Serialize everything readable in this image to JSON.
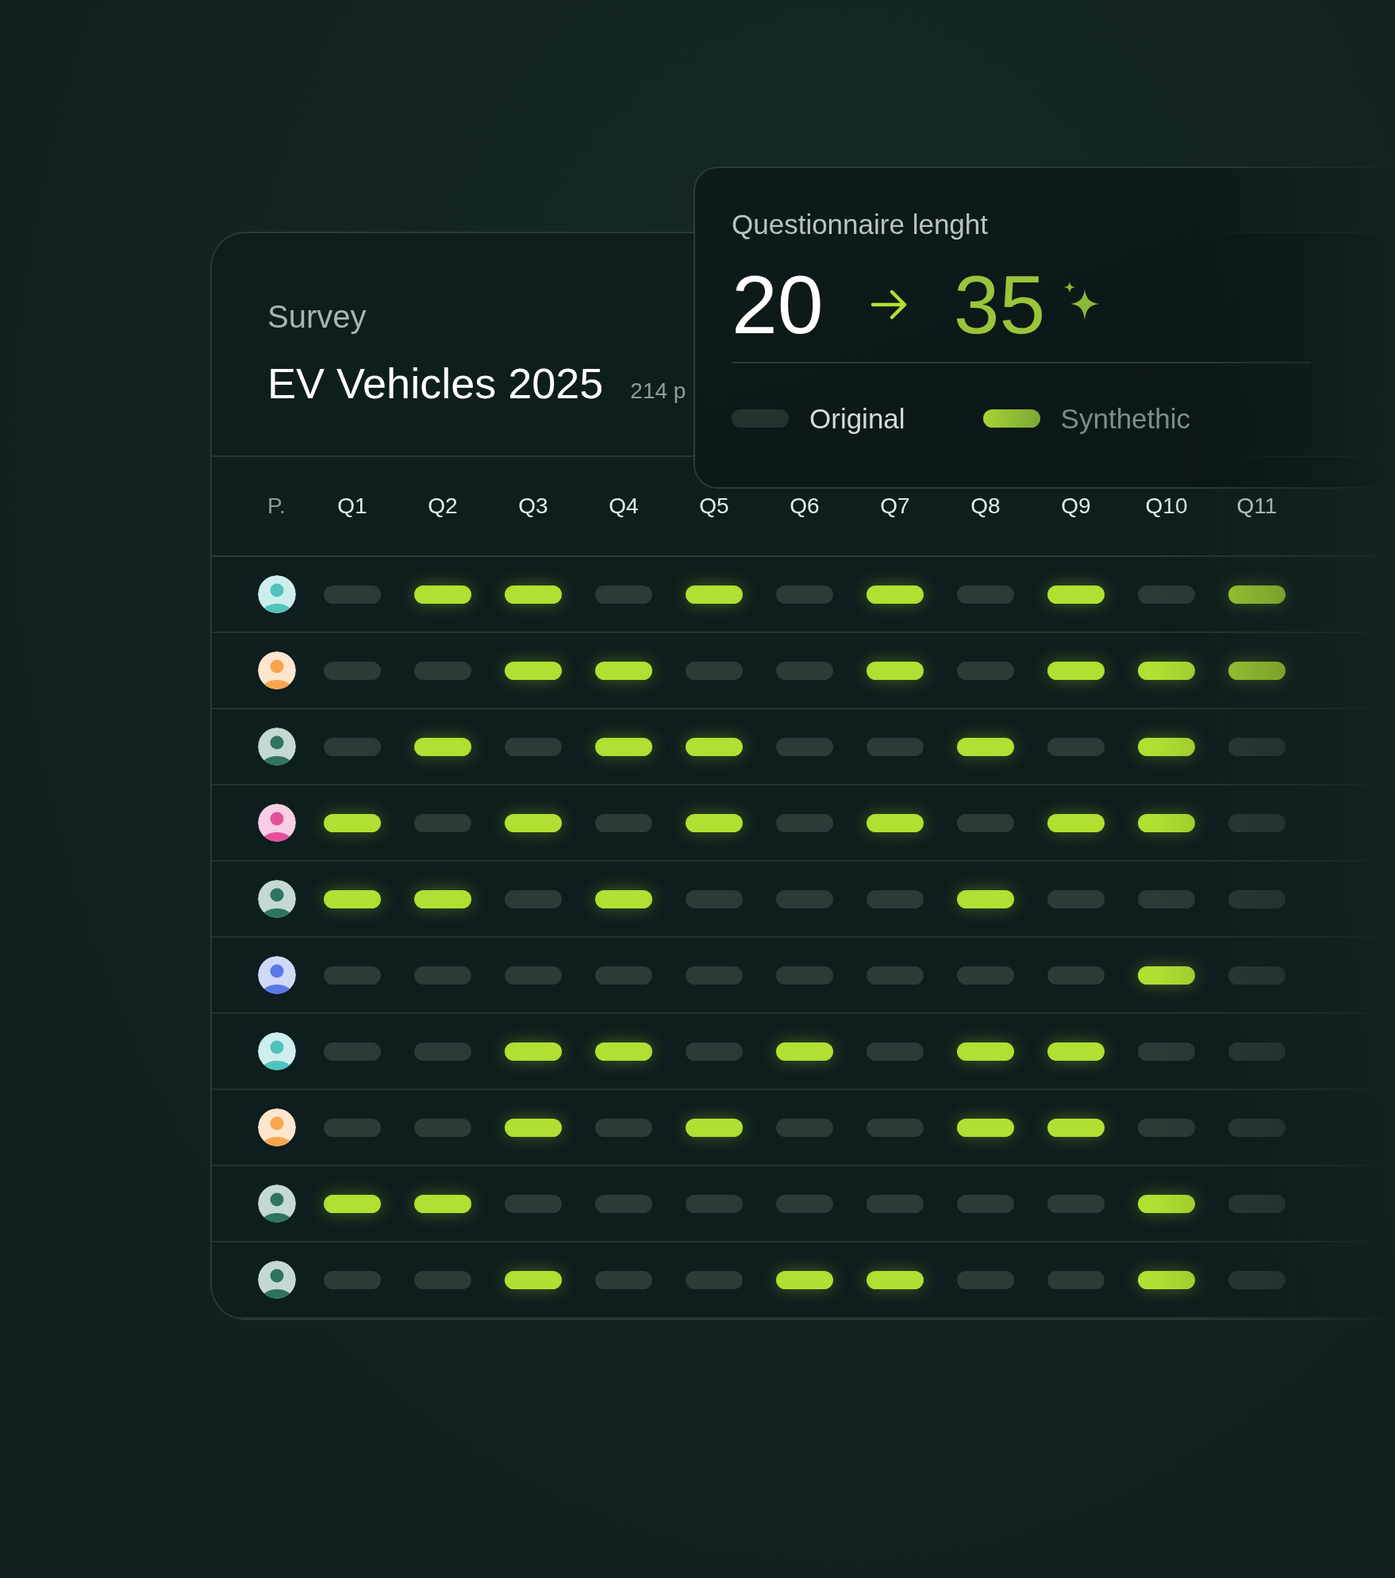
{
  "survey": {
    "label": "Survey",
    "title": "EV Vehicles 2025",
    "count": "214 p"
  },
  "popover": {
    "title": "Questionnaire lenght",
    "from": "20",
    "to": "35",
    "legend": [
      {
        "kind": "original",
        "label": "Original"
      },
      {
        "kind": "synthetic",
        "label": "Synthethic"
      }
    ]
  },
  "table": {
    "columns": [
      "P.",
      "Q1",
      "Q2",
      "Q3",
      "Q4",
      "Q5",
      "Q6",
      "Q7",
      "Q8",
      "Q9",
      "Q10",
      "Q11"
    ],
    "rows": [
      {
        "color": "#4fc4bd",
        "synthetic": [
          false,
          true,
          true,
          false,
          true,
          false,
          true,
          false,
          true,
          false,
          true
        ]
      },
      {
        "color": "#f9a54e",
        "synthetic": [
          false,
          false,
          true,
          true,
          false,
          false,
          true,
          false,
          true,
          true,
          true
        ]
      },
      {
        "color": "#2f7463",
        "synthetic": [
          false,
          true,
          false,
          true,
          true,
          false,
          false,
          true,
          false,
          true,
          false
        ]
      },
      {
        "color": "#e4519a",
        "synthetic": [
          true,
          false,
          true,
          false,
          true,
          false,
          true,
          false,
          true,
          true,
          false
        ]
      },
      {
        "color": "#2f7463",
        "synthetic": [
          true,
          true,
          false,
          true,
          false,
          false,
          false,
          true,
          false,
          false,
          false
        ]
      },
      {
        "color": "#5b78e8",
        "synthetic": [
          false,
          false,
          false,
          false,
          false,
          false,
          false,
          false,
          false,
          true,
          false
        ]
      },
      {
        "color": "#4fc4bd",
        "synthetic": [
          false,
          false,
          true,
          true,
          false,
          true,
          false,
          true,
          true,
          false,
          false
        ]
      },
      {
        "color": "#f9a54e",
        "synthetic": [
          false,
          false,
          true,
          false,
          true,
          false,
          false,
          true,
          true,
          false,
          false
        ]
      },
      {
        "color": "#2f7463",
        "synthetic": [
          true,
          true,
          false,
          false,
          false,
          false,
          false,
          false,
          false,
          true,
          false
        ]
      },
      {
        "color": "#2f7463",
        "synthetic": [
          false,
          false,
          true,
          false,
          false,
          true,
          true,
          false,
          false,
          true,
          false
        ]
      }
    ]
  }
}
